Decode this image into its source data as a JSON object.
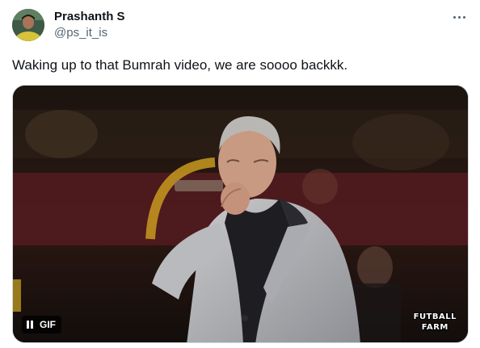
{
  "post": {
    "author": {
      "display_name": "Prashanth S",
      "handle": "@ps_it_is"
    },
    "more_icon": "more-horizontal-icon",
    "text": "Waking up to that Bumrah video, we are soooo backkk.",
    "media": {
      "badge_label": "GIF",
      "badge_icon": "pause-icon",
      "watermark_line1": "FUTBALL",
      "watermark_line2": "FARM"
    }
  },
  "colors": {
    "text_primary": "#0f1419",
    "text_secondary": "#536471",
    "border": "#cfd9de"
  }
}
